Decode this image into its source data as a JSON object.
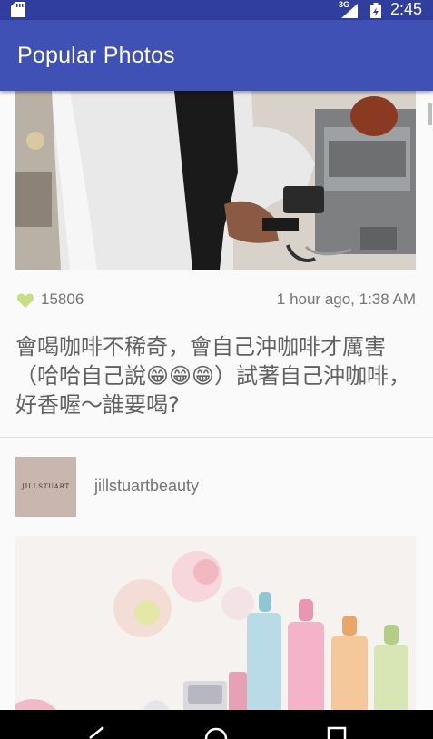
{
  "status_bar": {
    "network_type": "3G",
    "time": "2:45",
    "icons": [
      "sd-card-icon",
      "signal-icon",
      "battery-icon"
    ]
  },
  "app_bar": {
    "title": "Popular Photos"
  },
  "feed": {
    "posts": [
      {
        "likes": "15806",
        "timestamp": "1 hour ago, 1:38 AM",
        "caption": "會喝咖啡不稀奇，會自己沖咖啡才厲害（哈哈自己說😁😁😁）試著自己沖咖啡，好香喔～誰要喝?"
      },
      {
        "username": "jillstuartbeauty",
        "avatar_text": "JILLSTUART"
      }
    ]
  },
  "nav_bar": {
    "buttons": [
      "back-icon",
      "home-icon",
      "recents-icon"
    ]
  },
  "colors": {
    "status_bar": "#303f9f",
    "app_bar": "#3f51b5",
    "like_heart": "#c6df84",
    "secondary_text": "#757575"
  }
}
